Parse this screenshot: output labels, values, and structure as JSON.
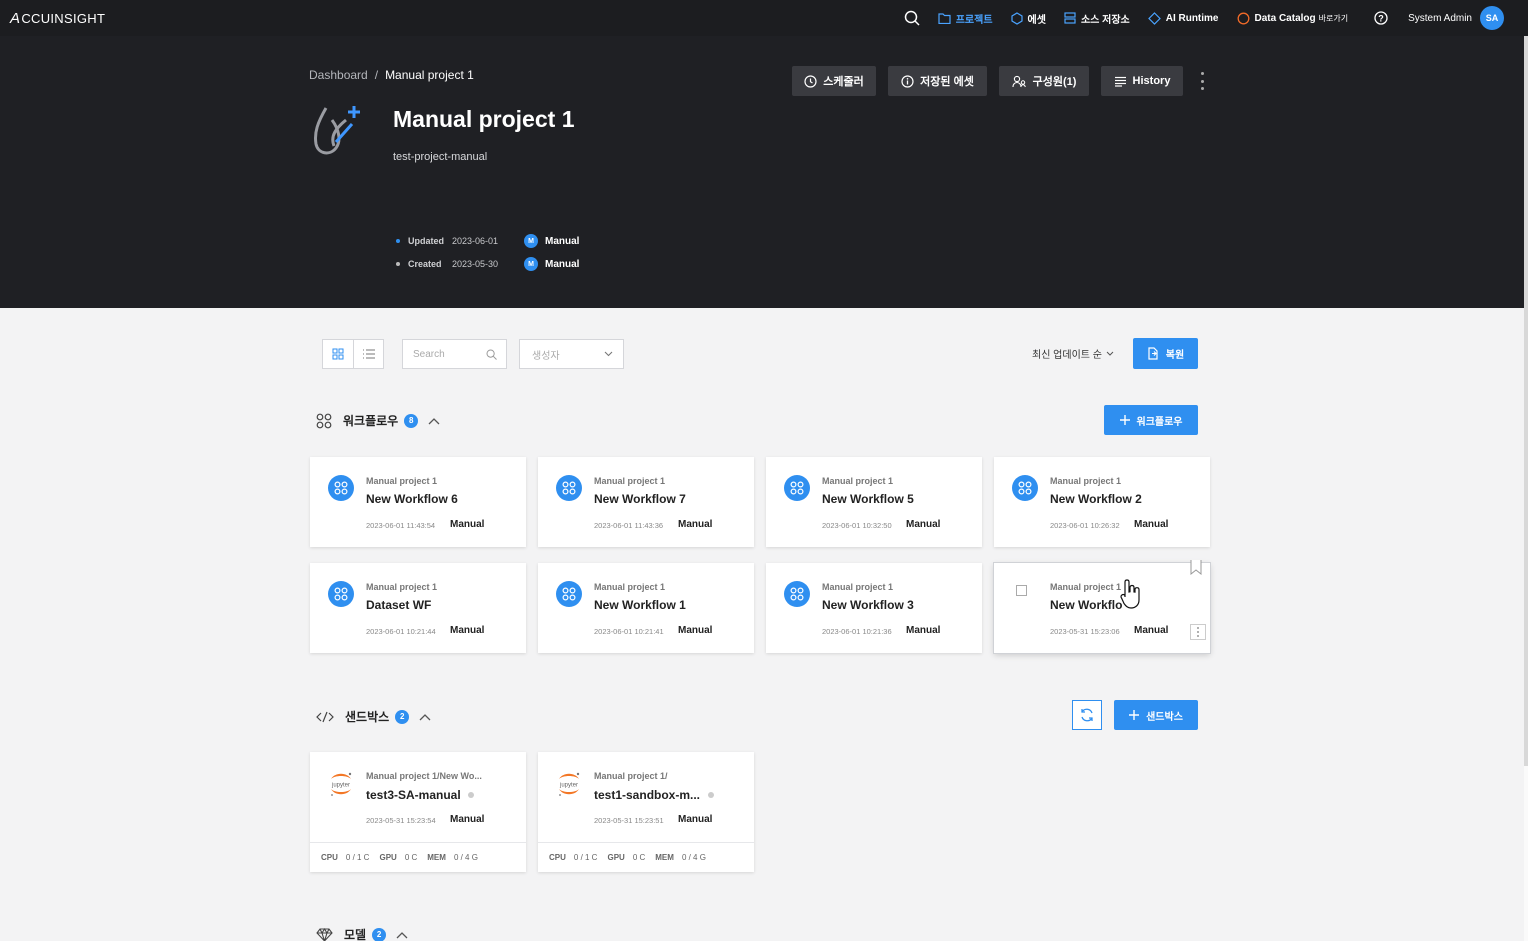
{
  "app": {
    "logo": "CCUINSIGHT",
    "logo_mark": "A",
    "nav": {
      "project": "프로젝트",
      "asset": "에셋",
      "storage": "소스 저장소",
      "runtime": "AI Runtime",
      "catalog": "Data Catalog",
      "catalog_sub": "바로가기"
    },
    "user_name": "System Admin",
    "user_initials": "SA"
  },
  "header": {
    "breadcrumb_root": "Dashboard",
    "breadcrumb_sep": "/",
    "breadcrumb_current": "Manual project 1",
    "title": "Manual project 1",
    "subtitle": "test-project-manual",
    "updated_label": "Updated",
    "updated_date": "2023-06-01",
    "updated_by_initial": "M",
    "updated_by": "Manual",
    "created_label": "Created",
    "created_date": "2023-05-30",
    "created_by_initial": "M",
    "created_by": "Manual",
    "buttons": {
      "scheduler": "스케줄러",
      "saved_assets": "저장된 에셋",
      "members": "구성원(1)",
      "history": "History"
    }
  },
  "toolbar": {
    "search_placeholder": "Search",
    "creator_placeholder": "생성자",
    "sort": "최신 업데이트 순",
    "restore": "복원"
  },
  "workflows": {
    "title": "워크플로우",
    "count": "8",
    "add": "워크플로우",
    "items": [
      {
        "project": "Manual project 1",
        "name": "New Workflow 6",
        "ts": "2023-06-01 11:43:54",
        "by": "Manual"
      },
      {
        "project": "Manual project 1",
        "name": "New Workflow 7",
        "ts": "2023-06-01 11:43:36",
        "by": "Manual"
      },
      {
        "project": "Manual project 1",
        "name": "New Workflow 5",
        "ts": "2023-06-01 10:32:50",
        "by": "Manual"
      },
      {
        "project": "Manual project 1",
        "name": "New Workflow 2",
        "ts": "2023-06-01 10:26:32",
        "by": "Manual"
      },
      {
        "project": "Manual project 1",
        "name": "Dataset WF",
        "ts": "2023-06-01 10:21:44",
        "by": "Manual"
      },
      {
        "project": "Manual project 1",
        "name": "New Workflow 1",
        "ts": "2023-06-01 10:21:41",
        "by": "Manual"
      },
      {
        "project": "Manual project 1",
        "name": "New Workflow 3",
        "ts": "2023-06-01 10:21:36",
        "by": "Manual"
      },
      {
        "project": "Manual project 1",
        "name": "New Workflo",
        "ts": "2023-05-31 15:23:06",
        "by": "Manual"
      }
    ]
  },
  "sandbox": {
    "title": "샌드박스",
    "count": "2",
    "add": "샌드박스",
    "items": [
      {
        "project": "Manual project 1/New Wo...",
        "name": "test3-SA-manual",
        "ts": "2023-05-31 15:23:54",
        "by": "Manual",
        "logo": "jupyter",
        "cpu_label": "CPU",
        "cpu": "0 / 1 C",
        "gpu_label": "GPU",
        "gpu": "0 C",
        "mem_label": "MEM",
        "mem": "0 / 4 G"
      },
      {
        "project": "Manual project 1/",
        "name": "test1-sandbox-m...",
        "ts": "2023-05-31 15:23:51",
        "by": "Manual",
        "logo": "jupyter",
        "cpu_label": "CPU",
        "cpu": "0 / 1 C",
        "gpu_label": "GPU",
        "gpu": "0 C",
        "mem_label": "MEM",
        "mem": "0 / 4 G"
      }
    ]
  },
  "models": {
    "title": "모델",
    "count": "2"
  },
  "colors": {
    "accent": "#2f8ff0",
    "header_bg": "#1f2024",
    "nav_bg": "#1c1d20",
    "page_bg": "#f3f3f4"
  }
}
